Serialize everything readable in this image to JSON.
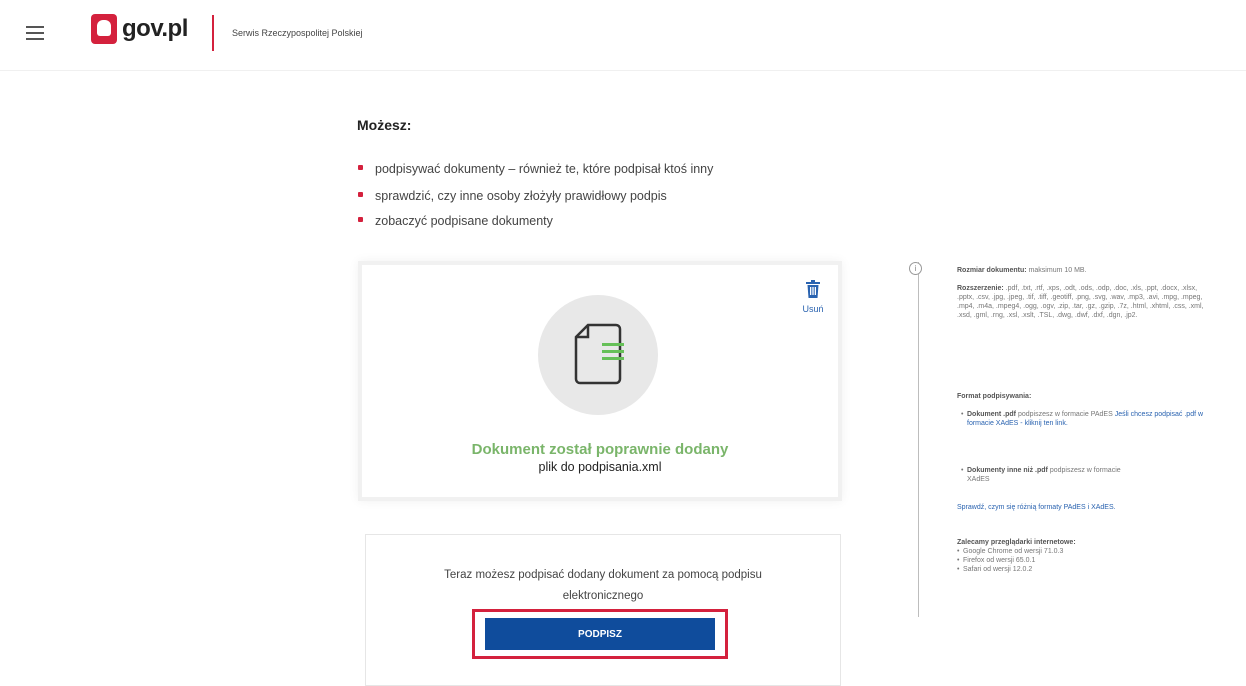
{
  "header": {
    "logo_text": "gov.pl",
    "service_name": "Serwis Rzeczypospolitej Polskiej",
    "brand_color": "#d4213d"
  },
  "main": {
    "title": "Możesz:",
    "bullets": [
      "podpisywać dokumenty – również te, które podpisał ktoś inny",
      "sprawdzić, czy inne osoby złożyły prawidłowy podpis",
      "zobaczyć podpisane dokumenty"
    ]
  },
  "upload": {
    "delete_label": "Usuń",
    "success_message": "Dokument został poprawnie dodany",
    "file_name": "plik do podpisania.xml"
  },
  "sign": {
    "text": "Teraz możesz podpisać dodany dokument za pomocą podpisu elektronicznego",
    "button_label": "PODPISZ",
    "button_color": "#0f4c9c"
  },
  "info": {
    "size_label": "Rozmiar dokumentu:",
    "size_value": "maksimum 10 MB.",
    "ext_label": "Rozszerzenie:",
    "ext_value": ".pdf, .txt, .rtf, .xps, .odt, .ods, .odp, .doc, .xls, .ppt, .docx, .xlsx, .pptx, .csv, .jpg, .jpeg, .tif, .tiff, .geotiff, .png, .svg, .wav, .mp3, .avi, .mpg, .mpeg, .mp4, .m4a, .mpeg4, .ogg, .ogv, .zip, .tar, .gz, .gzip, .7z, .html, .xhtml, .css, .xml, .xsd, .gml, .rng, .xsl, .xslt, .TSL, .dwg, .dwf, .dxf, .dgn, .jp2.",
    "format_label": "Format podpisywania:",
    "pdf_label": "Dokument .pdf",
    "pdf_text": "podpiszesz w formacie PAdES",
    "pdf_link": "Jeśli chcesz podpisać .pdf w formacie XAdES - kliknij ten link.",
    "other_label": "Dokumenty inne niż .pdf",
    "other_text": "podpiszesz w formacie XAdES",
    "diff_link": "Sprawdź, czym się różnią formaty PAdES i XAdES.",
    "browsers_label": "Zalecamy przeglądarki internetowe:",
    "browsers": [
      "Google Chrome od wersji 71.0.3",
      "Firefox od wersji 65.0.1",
      "Safari od wersji 12.0.2"
    ]
  }
}
